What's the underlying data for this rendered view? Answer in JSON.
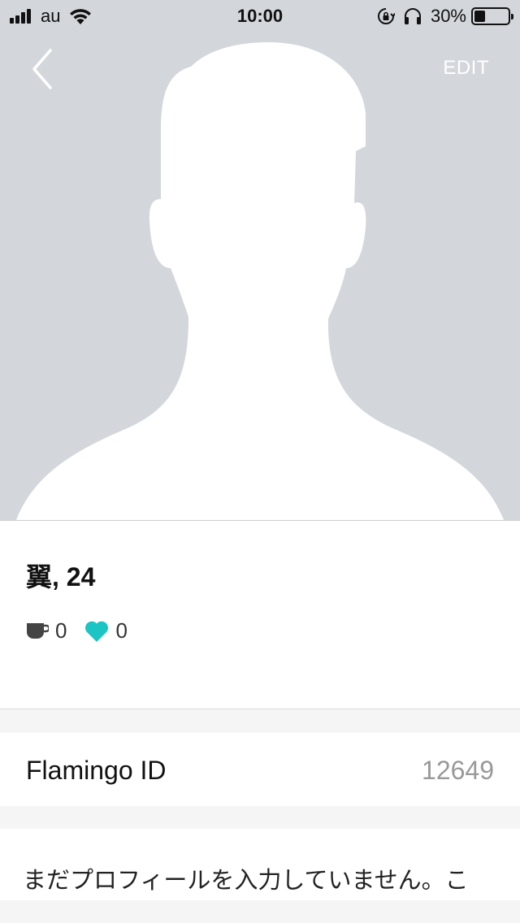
{
  "status_bar": {
    "carrier": "au",
    "time": "10:00",
    "battery_percent": "30%",
    "battery_level": 0.3
  },
  "nav": {
    "edit_label": "EDIT"
  },
  "profile": {
    "name_age": "翼, 24",
    "cups_count": "0",
    "likes_count": "0"
  },
  "id_row": {
    "label": "Flamingo ID",
    "value": "12649"
  },
  "bio": {
    "text": "まだプロフィールを入力していません。こ"
  },
  "colors": {
    "hero_bg": "#d3d7dc",
    "heart_accent": "#1cc4c4",
    "cup": "#444444"
  }
}
